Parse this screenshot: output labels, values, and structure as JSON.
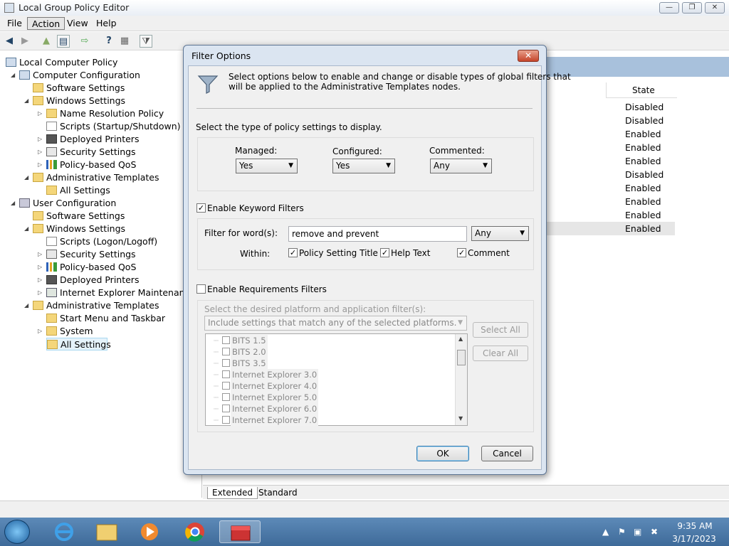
{
  "window": {
    "title": "Local Group Policy Editor",
    "controls": [
      "—",
      "❐",
      "✕"
    ]
  },
  "menu": [
    "File",
    "Action",
    "View",
    "Help"
  ],
  "tree": [
    {
      "label": "Local Computer Policy",
      "icon": "computer-policy-icon"
    },
    {
      "label": "Computer Configuration",
      "icon": "computer-icon"
    },
    {
      "label": "Software Settings",
      "icon": "folder-icon"
    },
    {
      "label": "Windows Settings",
      "icon": "folder-icon"
    },
    {
      "label": "Name Resolution Policy",
      "icon": "folder-icon"
    },
    {
      "label": "Scripts (Startup/Shutdown)",
      "icon": "script-icon"
    },
    {
      "label": "Deployed Printers",
      "icon": "printer-icon"
    },
    {
      "label": "Security Settings",
      "icon": "security-icon"
    },
    {
      "label": "Policy-based QoS",
      "icon": "chart-icon"
    },
    {
      "label": "Administrative Templates",
      "icon": "folder-icon"
    },
    {
      "label": "All Settings",
      "icon": "folder-icon"
    },
    {
      "label": "User Configuration",
      "icon": "user-icon"
    },
    {
      "label": "Software Settings",
      "icon": "folder-icon"
    },
    {
      "label": "Windows Settings",
      "icon": "folder-icon"
    },
    {
      "label": "Scripts (Logon/Logoff)",
      "icon": "script-icon"
    },
    {
      "label": "Security Settings",
      "icon": "security-icon"
    },
    {
      "label": "Policy-based QoS",
      "icon": "chart-icon"
    },
    {
      "label": "Deployed Printers",
      "icon": "printer-icon"
    },
    {
      "label": "Internet Explorer Maintenance",
      "icon": "ie-maintenance-icon"
    },
    {
      "label": "Administrative Templates",
      "icon": "folder-icon"
    },
    {
      "label": "Start Menu and Taskbar",
      "icon": "folder-icon"
    },
    {
      "label": "System",
      "icon": "folder-icon"
    },
    {
      "label": "All Settings",
      "icon": "folder-icon"
    }
  ],
  "list": {
    "state_header": "State",
    "states": [
      "Disabled",
      "Disabled",
      "Enabled",
      "Enabled",
      "Enabled",
      "Disabled",
      "Enabled",
      "Enabled",
      "Enabled",
      "Enabled"
    ]
  },
  "tabs": [
    "Extended",
    "Standard"
  ],
  "dialog": {
    "title": "Filter Options",
    "close": "✕",
    "intro": "Select options below to enable and change or disable types of global filters that will be applied to the Administrative Templates nodes.",
    "intro_line1": "Select options below to enable and change or disable types of global filters that",
    "intro_line2": "will be applied to the Administrative Templates nodes.",
    "type_prompt": "Select the type of policy settings to display.",
    "managed_label": "Managed:",
    "managed_value": "Yes",
    "configured_label": "Configured:",
    "configured_value": "Yes",
    "commented_label": "Commented:",
    "commented_value": "Any",
    "keyword_check": "Enable Keyword Filters",
    "keyword_checked": true,
    "filter_label": "Filter for word(s):",
    "filter_value": "remove and prevent",
    "match_value": "Any",
    "within_label": "Within:",
    "within_title": "Policy Setting Title",
    "within_help": "Help Text",
    "within_comment": "Comment",
    "req_check": "Enable Requirements Filters",
    "req_checked": false,
    "platform_prompt": "Select the desired platform and application filter(s):",
    "platform_combo": "Include settings that match any of the selected platforms.",
    "select_all": "Select All",
    "clear_all": "Clear All",
    "platforms": [
      "BITS 1.5",
      "BITS 2.0",
      "BITS 3.5",
      "Internet Explorer 3.0",
      "Internet Explorer 4.0",
      "Internet Explorer 5.0",
      "Internet Explorer 6.0",
      "Internet Explorer 7.0"
    ],
    "ok": "OK",
    "cancel": "Cancel"
  },
  "clock": {
    "time": "9:35 AM",
    "date": "3/17/2023"
  }
}
